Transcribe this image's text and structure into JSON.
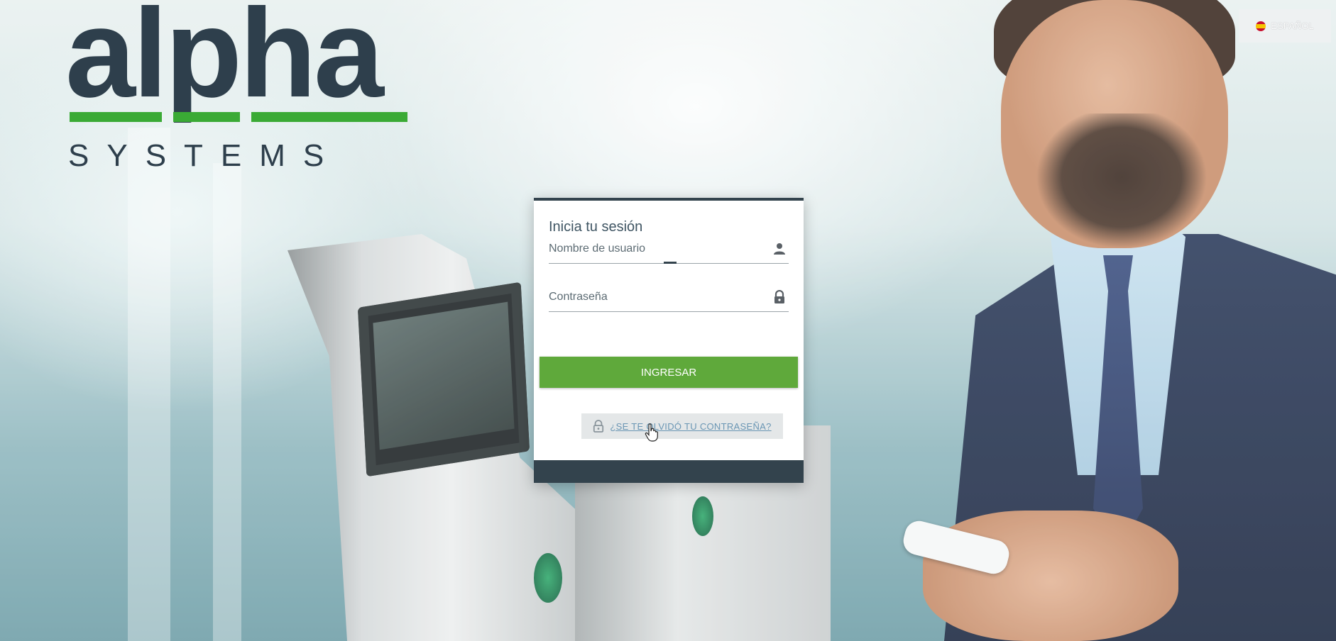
{
  "brand": {
    "logo_word": "alpha",
    "logo_sub": "SYSTEMS",
    "colors": {
      "dark": "#2e3f4c",
      "green": "#3aaa35"
    }
  },
  "language": {
    "label": "ESPAÑOL",
    "flag_icon": "spain-flag-icon"
  },
  "login": {
    "title": "Inicia tu sesión",
    "username": {
      "placeholder": "Nombre de usuario",
      "value": "",
      "icon": "user-icon"
    },
    "password": {
      "placeholder": "Contraseña",
      "value": "",
      "icon": "lock-icon"
    },
    "submit_label": "INGRESAR",
    "forgot_label": "¿SE TE OLVIDÓ TU CONTRASEÑA?",
    "forgot_icon": "unlock-icon",
    "colors": {
      "button": "#5fa93b",
      "header": "#33434d",
      "link": "#6a96b4"
    }
  }
}
